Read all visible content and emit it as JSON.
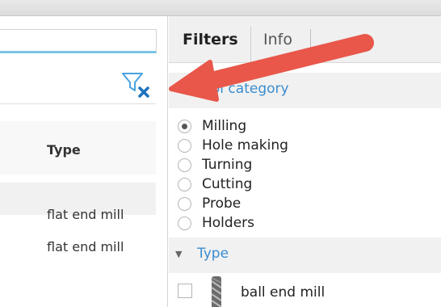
{
  "left_panel": {
    "search": {
      "value": "",
      "placeholder": ""
    },
    "clear_filter_icon": "filter-clear-icon",
    "columns": {
      "type": "Type"
    },
    "rows": [
      {
        "type": "flat end mill"
      },
      {
        "type": "flat end mill"
      }
    ]
  },
  "right_panel": {
    "tabs": [
      {
        "label": "Filters",
        "active": true
      },
      {
        "label": "Info",
        "active": false
      }
    ],
    "tool_category": {
      "title": "Tool category",
      "options": [
        {
          "label": "Milling",
          "selected": true
        },
        {
          "label": "Hole making",
          "selected": false
        },
        {
          "label": "Turning",
          "selected": false
        },
        {
          "label": "Cutting",
          "selected": false
        },
        {
          "label": "Probe",
          "selected": false
        },
        {
          "label": "Holders",
          "selected": false
        }
      ]
    },
    "type_section": {
      "title": "Type",
      "items": [
        {
          "label": "ball end mill",
          "checked": false
        }
      ]
    }
  },
  "annotation": {
    "color": "#e8574a"
  },
  "colors": {
    "accent_blue": "#3a8ccf",
    "search_underline": "#7cc3e6",
    "filter_icon": "#4aa3df"
  }
}
